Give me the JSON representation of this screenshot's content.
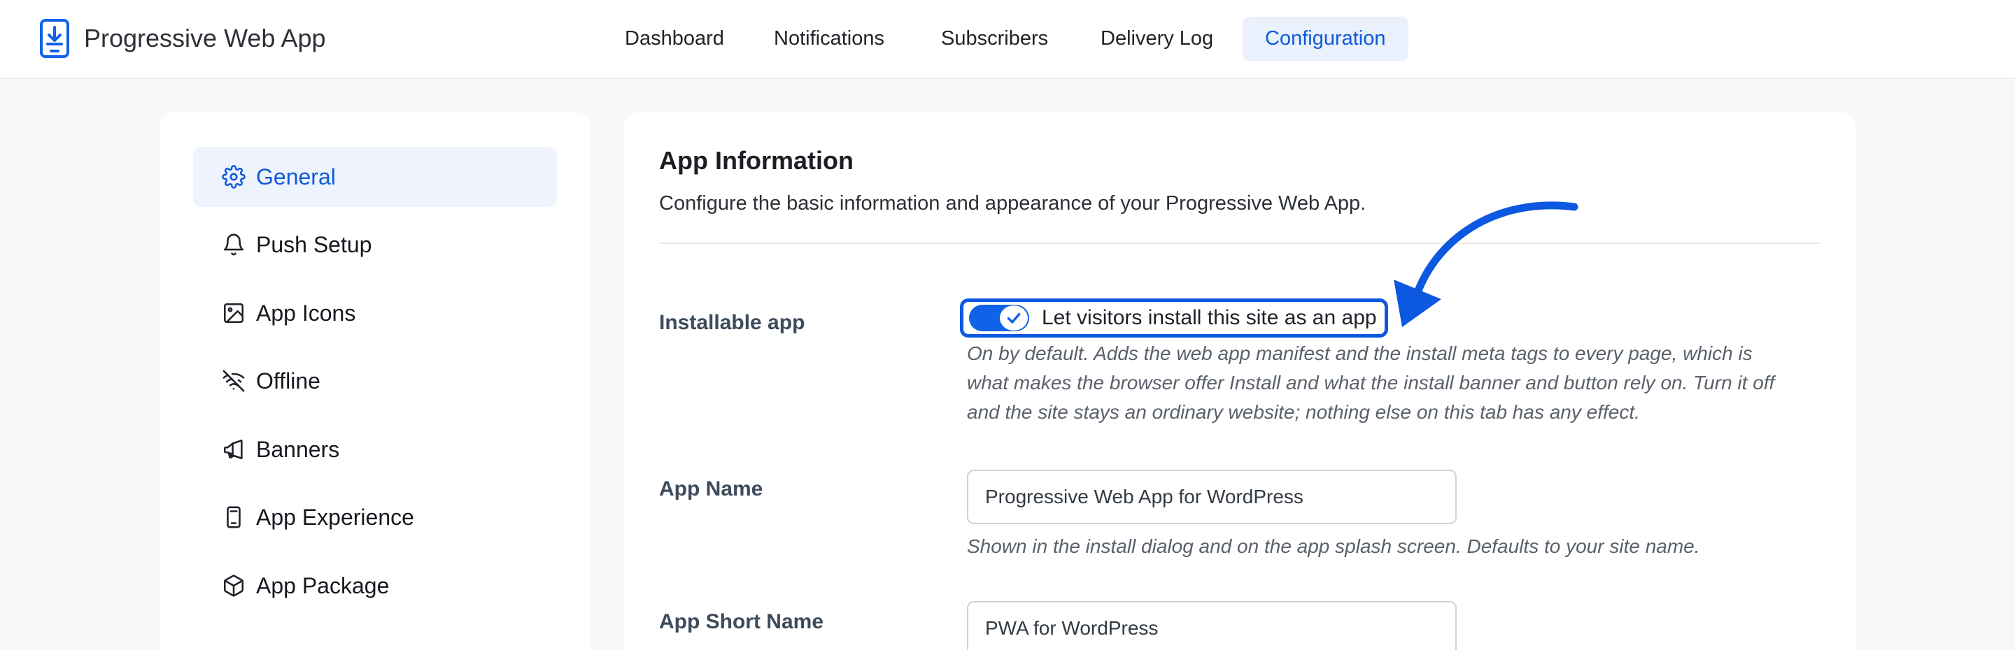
{
  "header": {
    "app_title": "Progressive Web App",
    "nav": [
      {
        "label": "Dashboard",
        "active": false
      },
      {
        "label": "Notifications",
        "active": false
      },
      {
        "label": "Subscribers",
        "active": false
      },
      {
        "label": "Delivery Log",
        "active": false
      },
      {
        "label": "Configuration",
        "active": true
      }
    ]
  },
  "sidebar": {
    "items": [
      {
        "label": "General",
        "icon": "gear-icon",
        "active": true
      },
      {
        "label": "Push Setup",
        "icon": "bell-icon",
        "active": false
      },
      {
        "label": "App Icons",
        "icon": "image-icon",
        "active": false
      },
      {
        "label": "Offline",
        "icon": "wifi-off-icon",
        "active": false
      },
      {
        "label": "Banners",
        "icon": "megaphone-icon",
        "active": false
      },
      {
        "label": "App Experience",
        "icon": "phone-icon",
        "active": false
      },
      {
        "label": "App Package",
        "icon": "box-icon",
        "active": false
      }
    ]
  },
  "main": {
    "title": "App Information",
    "description": "Configure the basic information and appearance of your Progressive Web App.",
    "fields": {
      "installable": {
        "label": "Installable app",
        "toggle_label": "Let visitors install this site as an app",
        "enabled": true,
        "help": "On by default. Adds the web app manifest and the install meta tags to every page, which is what makes the browser offer Install and what the install banner and button rely on. Turn it off and the site stays an ordinary website; nothing else on this tab has any effect."
      },
      "app_name": {
        "label": "App Name",
        "value": "Progressive Web App for WordPress",
        "help": "Shown in the install dialog and on the app splash screen. Defaults to your site name."
      },
      "app_short_name": {
        "label": "App Short Name",
        "value": "PWA for WordPress"
      }
    }
  },
  "colors": {
    "accent": "#0f5ad8",
    "annotation": "#0d58e0"
  }
}
